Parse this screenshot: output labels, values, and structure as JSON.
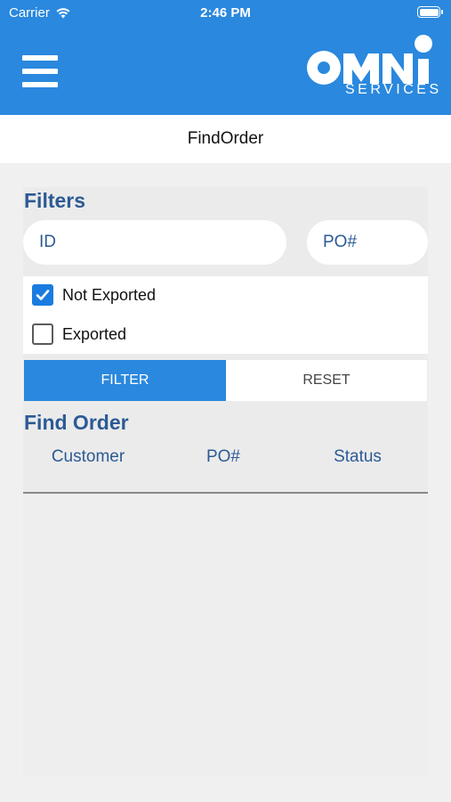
{
  "status_bar": {
    "carrier": "Carrier",
    "time": "2:46 PM"
  },
  "header": {
    "logo_services": "SERVICES",
    "menu_icon": "hamburger-menu-icon",
    "accent_color": "#2a88de"
  },
  "nav": {
    "title": "FindOrder"
  },
  "filters": {
    "title": "Filters",
    "id_placeholder": "ID",
    "po_placeholder": "PO#",
    "options": [
      {
        "label": "Not Exported",
        "checked": true
      },
      {
        "label": "Exported",
        "checked": false
      }
    ],
    "filter_label": "FILTER",
    "reset_label": "RESET"
  },
  "find_order": {
    "title": "Find Order",
    "columns": [
      "Customer",
      "PO#",
      "Status"
    ]
  }
}
